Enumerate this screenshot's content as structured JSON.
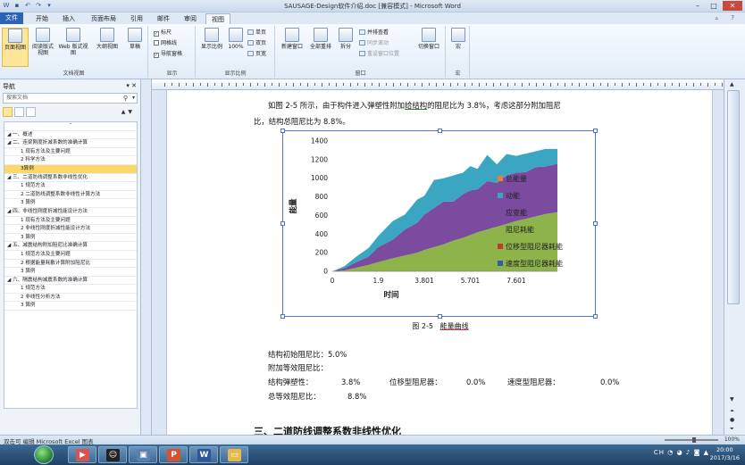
{
  "window": {
    "title": "SAUSAGE-Design软件介绍.doc [兼容模式] - Microsoft Word"
  },
  "tabs": [
    "文件",
    "开始",
    "插入",
    "页面布局",
    "引用",
    "邮件",
    "审阅",
    "视图"
  ],
  "active_tab": "视图",
  "ribbon": {
    "views": {
      "print": "页面视图",
      "read": "阅读版式视图",
      "web": "Web 版式视图",
      "outline": "大纲视图",
      "draft": "草稿",
      "label": "文档视图"
    },
    "show": {
      "ruler": "标尺",
      "grid": "网格线",
      "nav": "导航窗格",
      "label": "显示"
    },
    "zoom": {
      "zoom": "显示比例",
      "hundred": "100%",
      "one_page": "单页",
      "two_pages": "双页",
      "page_width": "页宽",
      "label": "显示比例"
    },
    "window": {
      "new": "新建窗口",
      "arrange": "全部重排",
      "split": "拆分",
      "side": "并排查看",
      "sync": "同步滚动",
      "reset": "重设窗口位置",
      "switch": "切换窗口",
      "label": "窗口"
    },
    "macro": {
      "macros": "宏",
      "label": "宏"
    }
  },
  "nav": {
    "title": "导航",
    "search_placeholder": "搜索文档",
    "outline": [
      "一、概述",
      "二、连梁刚度折减系数的准确计算",
      "1 现有方法及主要问题",
      "2 科学方法",
      "3算例",
      "三、二道防线调整系数非线性优化",
      "1 规范方法",
      "2 二道防线调整系数非线性计算方法",
      "3 算例",
      "四、非线性刚度折减性能设计方法",
      "1 现有方法及主要问题",
      "2 非线性刚度折减性能设计方法",
      "3 算例",
      "五、减震结构附加阻尼比准确计算",
      "1 规范方法及主要问题",
      "2 根据能量耗散计算附加阻尼比",
      "3 算例",
      "六、隔震结构减震系数的准确计算",
      "1 规范方法",
      "2 非线性分析方法",
      "3 算例"
    ],
    "selected_index": 4
  },
  "document": {
    "para1_a": "如图 2-5 所示，由于构件进入弹塑性附加",
    "para1_u": "给结构",
    "para1_b": "的阻尼比为 3.8%，考虑这部分附加阻尼",
    "para1_line2": "比，结构总阻尼比为 8.8%。",
    "caption_num": "图 2-5",
    "caption_text": "能量曲线",
    "line_initial": "结构初始阻尼比：5.0%",
    "line_added": "附加等效阻尼比：",
    "elastic_label": "结构弹塑性：",
    "elastic_val": "3.8%",
    "disp_label": "位移型阻尼器：",
    "disp_val": "0.0%",
    "vel_label": "速度型阻尼器：",
    "vel_val": "0.0%",
    "total_label": "总等效阻尼比：",
    "total_val": "8.8%",
    "heading_partial": "三、二道防线调整系数非线性优化"
  },
  "chart_data": {
    "type": "area",
    "title": "",
    "ylabel": "能量",
    "xlabel": "时间",
    "x_ticks": [
      "0",
      "1.9",
      "3.801",
      "5.701",
      "7.601"
    ],
    "x": [
      0,
      0.5,
      1.0,
      1.5,
      1.9,
      2.5,
      3.0,
      3.5,
      3.801,
      4.2,
      4.6,
      5.0,
      5.4,
      5.701,
      6.0,
      6.4,
      6.8,
      7.2,
      7.601,
      8.0,
      8.4,
      8.8,
      9.3
    ],
    "y_ticks": [
      0,
      200,
      400,
      600,
      800,
      1000,
      1200,
      1400
    ],
    "ylim": [
      0,
      1400
    ],
    "xlim": [
      0,
      9.3
    ],
    "stack_order": [
      "阻尼耗能",
      "应变能",
      "动能"
    ],
    "series": [
      {
        "name": "总能量",
        "color": "#ed7d31",
        "values": null
      },
      {
        "name": "动能",
        "color": "#3aa6c1",
        "values": [
          0,
          20,
          60,
          90,
          120,
          200,
          160,
          250,
          200,
          300,
          250,
          280,
          230,
          260,
          220,
          280,
          200,
          230,
          180,
          200,
          170,
          190,
          160
        ]
      },
      {
        "name": "应变能",
        "color": "#7b4ba0",
        "values": [
          0,
          25,
          60,
          90,
          160,
          200,
          280,
          320,
          380,
          420,
          460,
          420,
          470,
          480,
          460,
          520,
          470,
          520,
          520,
          500,
          530,
          510,
          520
        ]
      },
      {
        "name": "阻尼耗能",
        "color": "#8db34a",
        "values": [
          0,
          10,
          40,
          70,
          100,
          140,
          170,
          200,
          230,
          260,
          290,
          330,
          360,
          390,
          420,
          450,
          480,
          510,
          540,
          565,
          590,
          615,
          635
        ]
      },
      {
        "name": "位移型阻尼器耗能",
        "color": "#c0392b",
        "values": null
      },
      {
        "name": "速度型阻尼器耗能",
        "color": "#2e5fa8",
        "values": null
      }
    ],
    "legend_position": "right"
  },
  "status": {
    "text": "双击可 编辑 Microsoft Excel 图表",
    "zoom": "100%"
  },
  "taskbar": {
    "time": "20:00",
    "date": "2017/3/16",
    "lang": "CH"
  }
}
